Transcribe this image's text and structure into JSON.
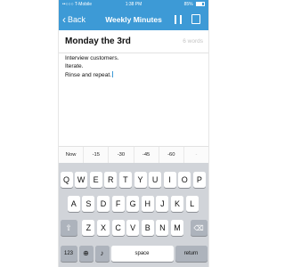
{
  "status_bar": {
    "carrier": "••○○○ T-Mobile",
    "time": "1:38 PM",
    "battery": "85%"
  },
  "nav": {
    "back_label": "Back",
    "title": "Weekly Minutes",
    "pause_icon": "pause-icon",
    "compose_icon": "compose-icon"
  },
  "note": {
    "date": "Monday the 3rd",
    "word_count": "6 words",
    "lines": [
      "Interview customers.",
      "Iterate.",
      "Rinse and repeat."
    ]
  },
  "toolbar": {
    "items": [
      "Now",
      "-15",
      "-30",
      "-45",
      "-60",
      "-"
    ]
  },
  "keyboard": {
    "row1": [
      "Q",
      "W",
      "E",
      "R",
      "T",
      "Y",
      "U",
      "I",
      "O",
      "P"
    ],
    "row2": [
      "A",
      "S",
      "D",
      "F",
      "G",
      "H",
      "J",
      "K",
      "L"
    ],
    "row3": [
      "Z",
      "X",
      "C",
      "V",
      "B",
      "N",
      "M"
    ],
    "numbers_label": "123",
    "space_label": "space",
    "return_label": "return",
    "globe_icon": "globe-icon",
    "mic_icon": "mic-icon",
    "shift_icon": "shift-icon",
    "delete_icon": "delete-icon"
  },
  "colors": {
    "accent": "#3d9ad6",
    "keyboard_bg": "#d1d4d9"
  }
}
